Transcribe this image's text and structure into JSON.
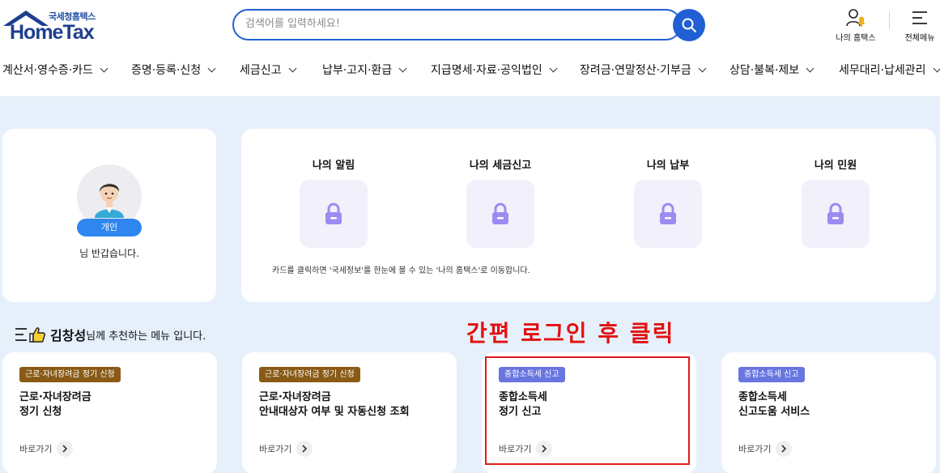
{
  "header": {
    "logo_sub": "국세청홈택스",
    "logo_main": "HomeTax",
    "search": {
      "placeholder": "검색어를 입력하세요!"
    },
    "my_hometax_label": "나의 홈택스",
    "all_menu_label": "전체메뉴"
  },
  "gnb": [
    {
      "label": "계산서·영수증·카드"
    },
    {
      "label": "증명·등록·신청"
    },
    {
      "label": "세금신고"
    },
    {
      "label": "납부·고지·환급"
    },
    {
      "label": "지급명세·자료·공익법인"
    },
    {
      "label": "장려금·연말정산·기부금"
    },
    {
      "label": "상담·불복·제보"
    },
    {
      "label": "세무대리·납세관리"
    }
  ],
  "profile": {
    "badge": "개인",
    "greeting": "님 반갑습니다."
  },
  "my_menu": {
    "items": [
      {
        "label": "나의 알림"
      },
      {
        "label": "나의 세금신고"
      },
      {
        "label": "나의 납부"
      },
      {
        "label": "나의 민원"
      }
    ],
    "description": "카드를 클릭하면 '국세정보'를 한눈에 볼 수 있는 '나의 홈택스'로 이동합니다."
  },
  "recommend": {
    "name": "김창성",
    "suffix": "님께 추천하는 메뉴 입니다."
  },
  "annotation": "간편 로그인 후 클릭",
  "services": [
    {
      "tag": "근로·자녀장려금 정기 신청",
      "tag_color": "#8a5a16",
      "title": "근로·자녀장려금\n정기 신청",
      "link": "바로가기"
    },
    {
      "tag": "근로·자녀장려금 정기 신청",
      "tag_color": "#8a5a16",
      "title": "근로·자녀장려금\n안내대상자 여부 및 자동신청 조회",
      "link": "바로가기"
    },
    {
      "tag": "종합소득세 신고",
      "tag_color": "#6976e0",
      "title": "종합소득세\n정기 신고",
      "link": "바로가기"
    },
    {
      "tag": "종합소득세 신고",
      "tag_color": "#6976e0",
      "title": "종합소득세\n신고도움 서비스",
      "link": "바로가기"
    }
  ],
  "colors": {
    "brand_blue": "#2160d4",
    "annotation_red": "#e21010",
    "page_bg": "#e6f0fb"
  }
}
